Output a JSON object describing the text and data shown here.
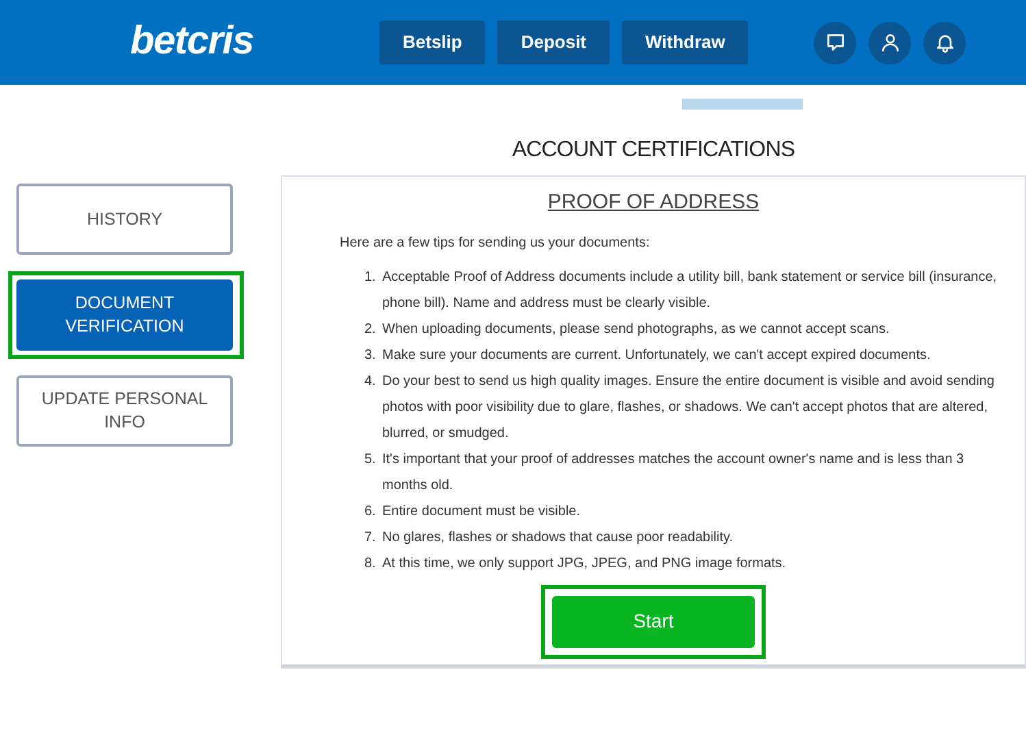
{
  "header": {
    "logo": "betcris",
    "buttons": [
      "Betslip",
      "Deposit",
      "Withdraw"
    ],
    "icons": [
      {
        "kind": "chat"
      },
      {
        "kind": "user"
      },
      {
        "kind": "bell"
      }
    ]
  },
  "page_title": "ACCOUNT CERTIFICATIONS",
  "sidebar": {
    "items": [
      {
        "label": "HISTORY",
        "selected": false,
        "highlighted": false
      },
      {
        "label": "DOCUMENT VERIFICATION",
        "selected": true,
        "highlighted": true
      },
      {
        "label": "UPDATE PERSONAL INFO",
        "selected": false,
        "highlighted": false
      }
    ]
  },
  "panel": {
    "title": "PROOF OF ADDRESS",
    "intro": "Here are a few tips for sending us your documents:",
    "tips": [
      {
        "number": "1.",
        "text": "Acceptable Proof of Address documents include a utility bill, bank statement or service bill (insurance, phone bill). Name and address must be clearly visible."
      },
      {
        "number": "2.",
        "text": "When uploading documents, please send photographs, as we cannot accept scans."
      },
      {
        "number": "3.",
        "text": "Make sure your documents are current. Unfortunately, we can't accept expired documents."
      },
      {
        "number": "4.",
        "text": "Do your best to send us high quality images. Ensure the entire document is visible and avoid sending photos with poor visibility due to glare, flashes, or shadows. We can't accept photos that are altered, blurred, or smudged."
      },
      {
        "number": "5.",
        "text": "It's important that your proof of addresses matches the account owner's name and is less than 3 months old."
      },
      {
        "number": "6.",
        "text": "Entire document must be visible."
      },
      {
        "number": "7.",
        "text": "No glares, flashes or shadows that cause poor readability."
      },
      {
        "number": "8.",
        "text": "At this time, we only support JPG, JPEG, and PNG image formats."
      }
    ],
    "start_button": {
      "label": "Start",
      "highlighted": true
    }
  }
}
